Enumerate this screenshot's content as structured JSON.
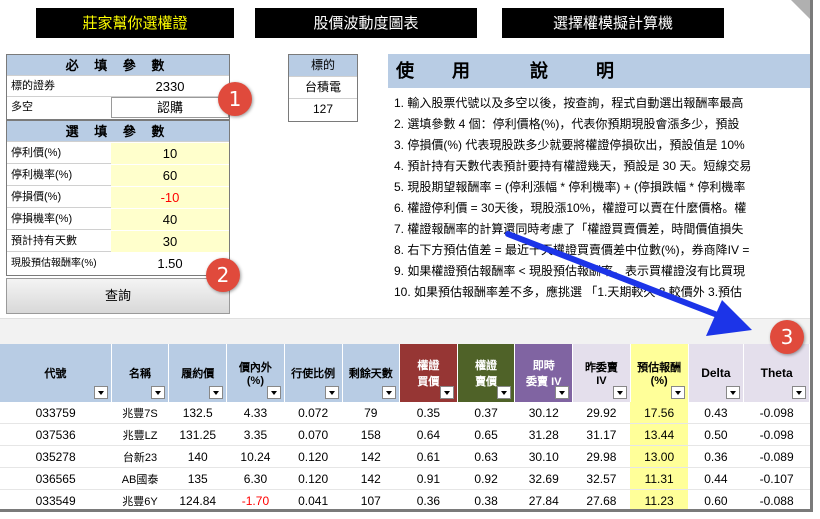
{
  "colors": {
    "header_blue": "#b8cce4",
    "input_yellow": "#ffffcc",
    "highlight_yellow": "#ffff99",
    "marker_red": "#e04a3c",
    "arrow_blue": "#1c34e8",
    "negative_red": "#ff0000"
  },
  "nav": {
    "btn1": "莊家幫你選權證",
    "btn2": "股價波動度圖表",
    "btn3": "選擇權模擬計算機"
  },
  "required": {
    "title": "必 填 參 數",
    "warrant_label": "標的證券",
    "warrant_value": "2330",
    "direction_label": "多空",
    "direction_value": "認購"
  },
  "optional": {
    "title": "選 填 參 數",
    "rows": [
      {
        "label": "停利價(%)",
        "value": "10"
      },
      {
        "label": "停利機率(%)",
        "value": "60"
      },
      {
        "label": "停損價(%)",
        "value": "-10"
      },
      {
        "label": "停損機率(%)",
        "value": "40"
      },
      {
        "label": "預計持有天數",
        "value": "30"
      },
      {
        "label": "現股預估報酬率(%)",
        "value": "1.50"
      }
    ]
  },
  "query_button": "查詢",
  "markers": [
    "1",
    "2",
    "3"
  ],
  "ticker": {
    "label": "標的",
    "name": "台積電",
    "code": "127"
  },
  "instructions": {
    "title_chars": [
      "使",
      "用",
      "說",
      "明"
    ],
    "lines": [
      "1. 輸入股票代號以及多空以後，按查詢，程式自動選出報酬率最高",
      "2. 選填參數 4 個：停利價格(%)，代表你預期現股會漲多少，預設",
      "3. 停損價(%) 代表現股跌多少就要將權證停損砍出，預設值是 10%",
      "4. 預計持有天數代表預計要持有權證幾天，預設是 30 天。短線交易",
      "5. 現股期望報酬率 = (停利漲幅 * 停利機率) + (停損跌幅 * 停利機率",
      "6. 權證停利價 = 30天後，現股漲10%，權證可以賣在什麼價格。權",
      "7. 權證報酬率的計算還同時考慮了「權證買賣價差，時間價值損失",
      "8. 右下方預估值差 = 最近十天權證買賣價差中位數(%)，券商降IV =",
      "9. 如果權證預估報酬率 < 現股預估報酬率，表示買權證沒有比買現",
      "10. 如果預估報酬率差不多，應挑選 「1.天期較久 2.較價外 3.預估"
    ]
  },
  "table": {
    "headers": [
      "代號",
      "名稱",
      "履約價",
      "價內外\n(%)",
      "行使比例",
      "剩餘天數",
      "權證\n買價",
      "權證\n賣價",
      "即時\n委賣 IV",
      "昨委賣\nIV",
      "預估報酬\n(%)",
      "Delta",
      "Theta"
    ],
    "rows": [
      [
        "033759",
        "兆豐7S",
        "132.5",
        "4.33",
        "0.072",
        "79",
        "0.35",
        "0.37",
        "30.12",
        "29.92",
        "17.56",
        "0.43",
        "-0.098"
      ],
      [
        "037536",
        "兆豐LZ",
        "131.25",
        "3.35",
        "0.070",
        "158",
        "0.64",
        "0.65",
        "31.28",
        "31.17",
        "13.44",
        "0.50",
        "-0.098"
      ],
      [
        "035278",
        "台新23",
        "140",
        "10.24",
        "0.120",
        "142",
        "0.61",
        "0.63",
        "30.10",
        "29.98",
        "13.00",
        "0.36",
        "-0.089"
      ],
      [
        "036565",
        "AB國泰",
        "135",
        "6.30",
        "0.120",
        "142",
        "0.91",
        "0.92",
        "32.69",
        "32.57",
        "11.31",
        "0.44",
        "-0.107"
      ],
      [
        "033549",
        "兆豐6Y",
        "124.84",
        "-1.70",
        "0.041",
        "107",
        "0.36",
        "0.38",
        "27.84",
        "27.68",
        "11.23",
        "0.60",
        "-0.088"
      ]
    ]
  }
}
